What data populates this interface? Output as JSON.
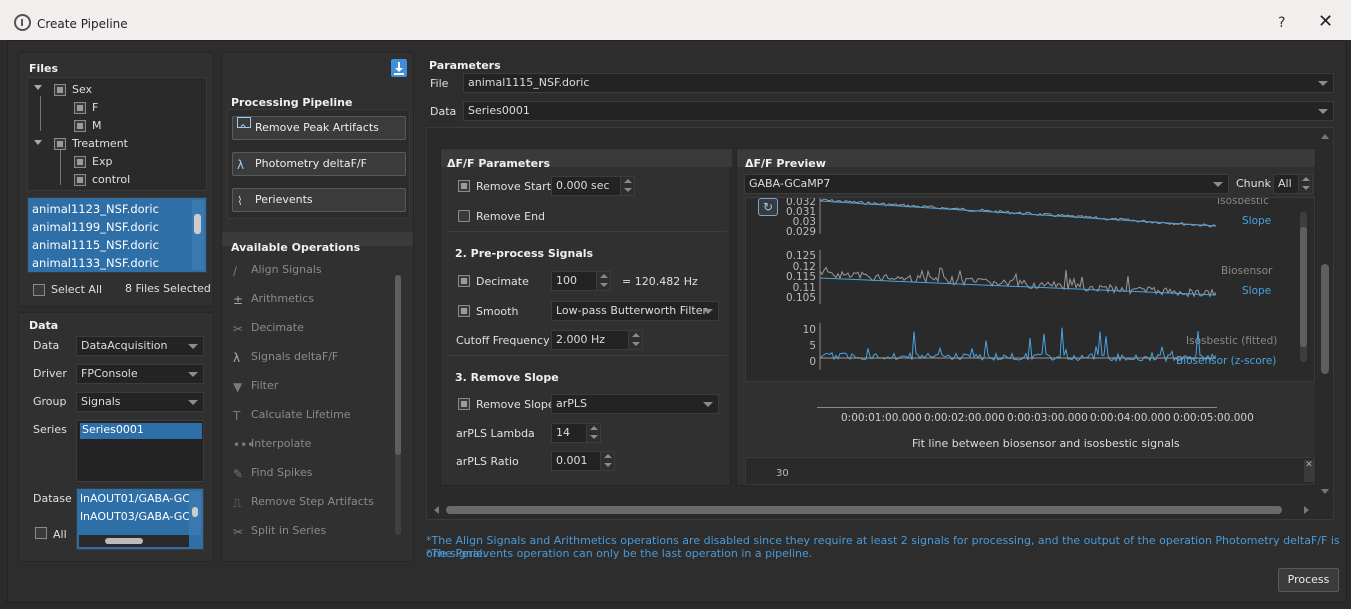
{
  "window": {
    "title": "Create Pipeline",
    "help": "?",
    "close": "✕"
  },
  "files": {
    "title": "Files",
    "tree": [
      {
        "label": "Sex"
      },
      {
        "label": "F"
      },
      {
        "label": "M"
      },
      {
        "label": "Treatment"
      },
      {
        "label": "Exp"
      },
      {
        "label": "control"
      }
    ],
    "list": [
      "animal1123_NSF.doric",
      "animal1199_NSF.doric",
      "animal1115_NSF.doric",
      "animal1133_NSF.doric"
    ],
    "select_all": "Select All",
    "selected_count": "8 Files Selected"
  },
  "data": {
    "title": "Data",
    "data_label": "Data",
    "data_value": "DataAcquisition",
    "driver_label": "Driver",
    "driver_value": "FPConsole",
    "group_label": "Group",
    "group_value": "Signals",
    "series_label": "Series",
    "series_items": [
      "Series0001"
    ],
    "dataset_label": "Datase",
    "dataset_items": [
      "lnAOUT01/GABA-GC",
      "lnAOUT03/GABA-GC"
    ],
    "all_label": "All"
  },
  "pipeline": {
    "title": "Processing Pipeline",
    "steps": [
      "Remove Peak Artifacts",
      "Photometry deltaF/F",
      "Perievents"
    ]
  },
  "operations": {
    "title": "Available Operations",
    "items": [
      "Align Signals",
      "Arithmetics",
      "Decimate",
      "Signals deltaF/F",
      "Filter",
      "Calculate Lifetime",
      "Interpolate",
      "Find Spikes",
      "Remove Step Artifacts",
      "Split in Series"
    ]
  },
  "params": {
    "title": "Parameters",
    "file_label": "File",
    "file_value": "animal1115_NSF.doric",
    "data_label": "Data",
    "data_value": "Series0001"
  },
  "dff": {
    "title": "ΔF/F Parameters",
    "remove_start": "Remove Start",
    "remove_start_value": "0.000 sec",
    "remove_end": "Remove End",
    "preprocess_title": "2. Pre-process Signals",
    "decimate": "Decimate",
    "decimate_value": "100",
    "decimate_hz": "= 120.482 Hz",
    "smooth": "Smooth",
    "smooth_value": "Low-pass Butterworth Filter",
    "cutoff": "Cutoff Frequency",
    "cutoff_value": "2.000 Hz",
    "slope_title": "3. Remove Slope",
    "remove_slope": "Remove Slope",
    "remove_slope_value": "arPLS",
    "lambda": "arPLS Lambda",
    "lambda_value": "14",
    "ratio": "arPLS Ratio",
    "ratio_value": "0.001"
  },
  "preview": {
    "title": "ΔF/F Preview",
    "channel": "GABA-GCaMP7",
    "chunk_label": "Chunk",
    "chunk_value": "All",
    "plot1_ticks": [
      "0.032",
      "0.031",
      "0.03",
      "0.029"
    ],
    "plot1_labels": [
      "Isosbestic",
      "Slope"
    ],
    "plot2_ticks": [
      "0.125",
      "0.12",
      "0.115",
      "0.11",
      "0.105"
    ],
    "plot2_labels": [
      "Biosensor",
      "Slope"
    ],
    "plot3_ticks": [
      "10",
      "5",
      "0"
    ],
    "plot3_labels": [
      "Isosbestic (fitted)",
      "Biosensor (z-score)"
    ],
    "x_ticks": [
      "0:00:01:00.000",
      "0:00:02:00.000",
      "0:00:03:00.000",
      "0:00:04:00.000",
      "0:00:05:00.000"
    ],
    "caption": "Fit line between biosensor and isosbestic signals",
    "bottom_tick": "30"
  },
  "notes": [
    "*The Align Signals and Arithmetics operations are disabled since they require at least 2 signals for processing, and the output of the operation Photometry deltaF/F is one signal.",
    "*The Perievents operation can only be the last operation in a pipeline."
  ],
  "process_button": "Process",
  "colors": {
    "accent": "#2f6fa8",
    "trace_gray": "#9a9a9a",
    "trace_blue": "#4aa3e0",
    "note": "#4a9ad8"
  }
}
